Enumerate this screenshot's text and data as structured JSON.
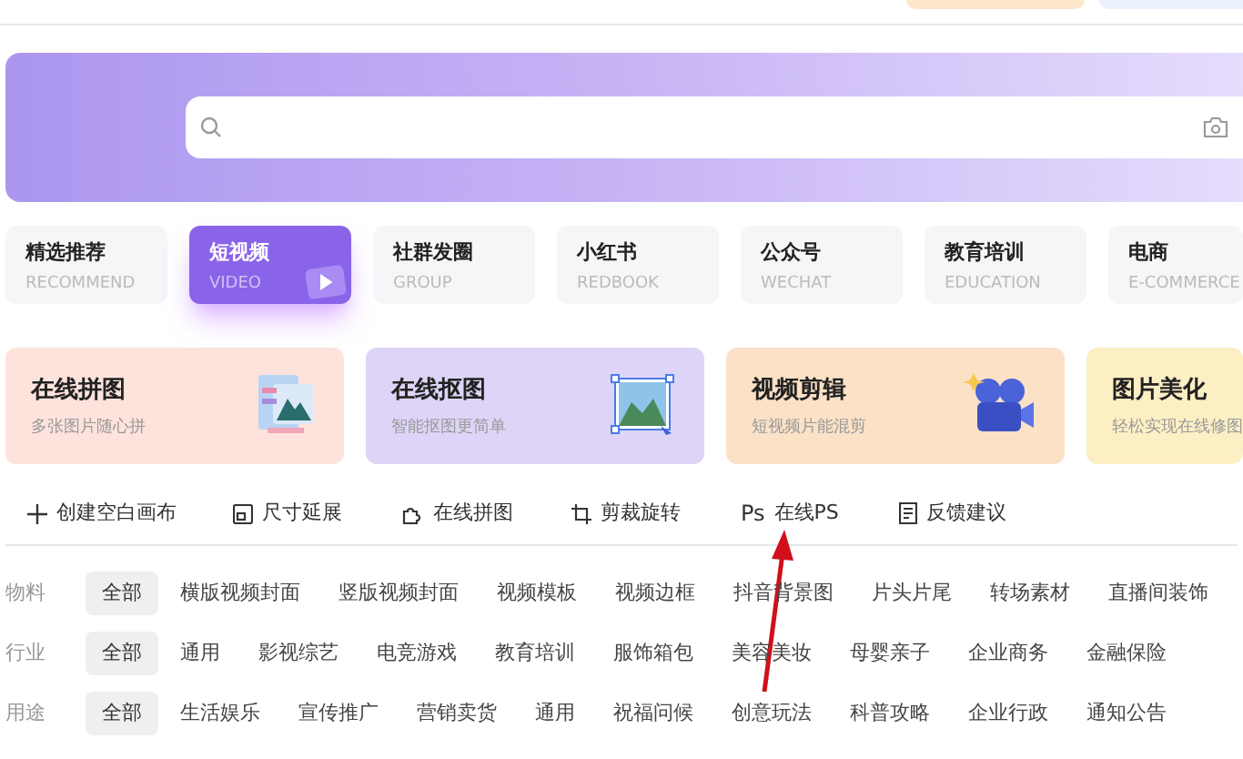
{
  "categories": [
    {
      "title": "精选推荐",
      "subtitle": "RECOMMEND",
      "selected": false
    },
    {
      "title": "短视频",
      "subtitle": "VIDEO",
      "selected": true
    },
    {
      "title": "社群发圈",
      "subtitle": "GROUP",
      "selected": false
    },
    {
      "title": "小红书",
      "subtitle": "REDBOOK",
      "selected": false
    },
    {
      "title": "公众号",
      "subtitle": "WECHAT",
      "selected": false
    },
    {
      "title": "教育培训",
      "subtitle": "EDUCATION",
      "selected": false
    },
    {
      "title": "电商",
      "subtitle": "E-COMMERCE",
      "selected": false
    }
  ],
  "feature_cards": [
    {
      "title": "在线拼图",
      "subtitle": "多张图片随心拼",
      "kind": "collage",
      "color": "#fde3dc"
    },
    {
      "title": "在线抠图",
      "subtitle": "智能抠图更简单",
      "kind": "cutout",
      "color": "#ddd4f7"
    },
    {
      "title": "视频剪辑",
      "subtitle": "短视频片能混剪",
      "kind": "video",
      "color": "#fbe1c6"
    },
    {
      "title": "图片美化",
      "subtitle": "轻松实现在线修图",
      "kind": "beauty",
      "color": "#fcefc4"
    }
  ],
  "tools": [
    {
      "label": "创建空白画布",
      "kind": "plus"
    },
    {
      "label": "尺寸延展",
      "kind": "resize"
    },
    {
      "label": "在线拼图",
      "kind": "puzzle"
    },
    {
      "label": "剪裁旋转",
      "kind": "crop"
    },
    {
      "label": "在线PS",
      "kind": "ps",
      "icon_text": "Ps"
    },
    {
      "label": "反馈建议",
      "kind": "feedback"
    }
  ],
  "filters": [
    {
      "label": "物料",
      "options": [
        {
          "label": "全部",
          "selected": true
        },
        {
          "label": "横版视频封面",
          "selected": false
        },
        {
          "label": "竖版视频封面",
          "selected": false
        },
        {
          "label": "视频模板",
          "selected": false
        },
        {
          "label": "视频边框",
          "selected": false
        },
        {
          "label": "抖音背景图",
          "selected": false
        },
        {
          "label": "片头片尾",
          "selected": false
        },
        {
          "label": "转场素材",
          "selected": false
        },
        {
          "label": "直播间装饰",
          "selected": false
        }
      ]
    },
    {
      "label": "行业",
      "options": [
        {
          "label": "全部",
          "selected": true
        },
        {
          "label": "通用",
          "selected": false
        },
        {
          "label": "影视综艺",
          "selected": false
        },
        {
          "label": "电竞游戏",
          "selected": false
        },
        {
          "label": "教育培训",
          "selected": false
        },
        {
          "label": "服饰箱包",
          "selected": false
        },
        {
          "label": "美容美妆",
          "selected": false
        },
        {
          "label": "母婴亲子",
          "selected": false
        },
        {
          "label": "企业商务",
          "selected": false
        },
        {
          "label": "金融保险",
          "selected": false
        }
      ]
    },
    {
      "label": "用途",
      "options": [
        {
          "label": "全部",
          "selected": true
        },
        {
          "label": "生活娱乐",
          "selected": false
        },
        {
          "label": "宣传推广",
          "selected": false
        },
        {
          "label": "营销卖货",
          "selected": false
        },
        {
          "label": "通用",
          "selected": false
        },
        {
          "label": "祝福问候",
          "selected": false
        },
        {
          "label": "创意玩法",
          "selected": false
        },
        {
          "label": "科普攻略",
          "selected": false
        },
        {
          "label": "企业行政",
          "selected": false
        },
        {
          "label": "通知公告",
          "selected": false
        }
      ]
    }
  ]
}
